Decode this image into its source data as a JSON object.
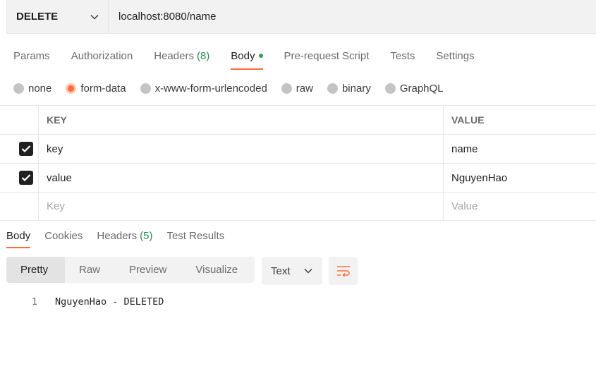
{
  "request": {
    "method": "DELETE",
    "url": "localhost:8080/name"
  },
  "request_tabs": [
    {
      "label": "Params"
    },
    {
      "label": "Authorization"
    },
    {
      "label": "Headers",
      "count": "(8)"
    },
    {
      "label": "Body",
      "active": true
    },
    {
      "label": "Pre-request Script"
    },
    {
      "label": "Tests"
    },
    {
      "label": "Settings"
    }
  ],
  "body_types": [
    {
      "label": "none"
    },
    {
      "label": "form-data",
      "selected": true
    },
    {
      "label": "x-www-form-urlencoded"
    },
    {
      "label": "raw"
    },
    {
      "label": "binary"
    },
    {
      "label": "GraphQL"
    }
  ],
  "params_table": {
    "headers": {
      "key": "KEY",
      "value": "VALUE"
    },
    "rows": [
      {
        "key": "key",
        "value": "name",
        "checked": true
      },
      {
        "key": "value",
        "value": "NguyenHao",
        "checked": true
      }
    ],
    "placeholder": {
      "key": "Key",
      "value": "Value"
    }
  },
  "response_tabs": [
    {
      "label": "Body",
      "active": true
    },
    {
      "label": "Cookies"
    },
    {
      "label": "Headers",
      "count": "(5)"
    },
    {
      "label": "Test Results"
    }
  ],
  "response_view": {
    "modes": [
      "Pretty",
      "Raw",
      "Preview",
      "Visualize"
    ],
    "format": "Text"
  },
  "response_body": [
    {
      "line": "1",
      "text": "NguyenHao - DELETED"
    }
  ],
  "colors": {
    "accent": "#ff6c37",
    "success": "#2e8a4f"
  }
}
